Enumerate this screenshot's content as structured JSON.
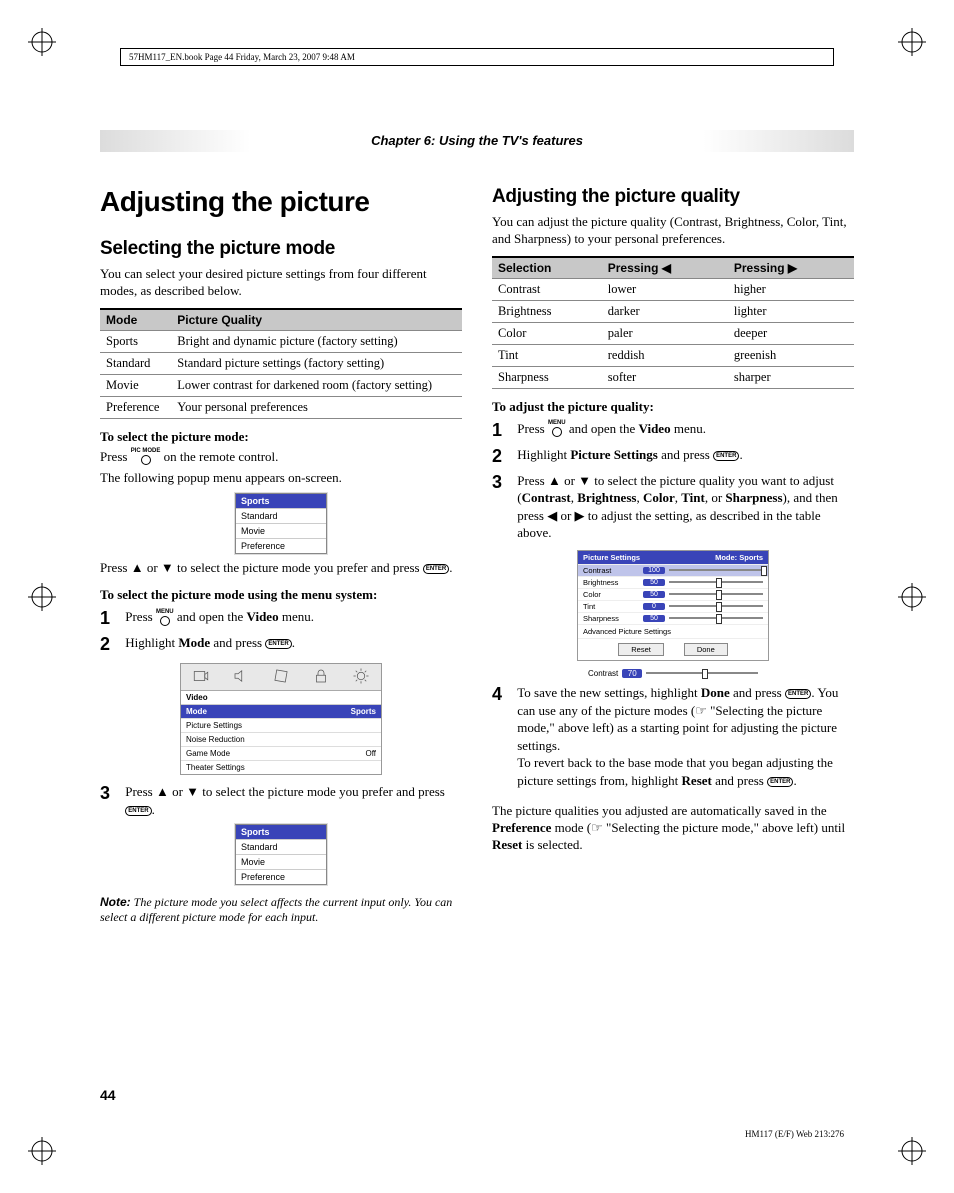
{
  "header_crop": "57HM117_EN.book  Page 44  Friday, March 23, 2007  9:48 AM",
  "chapter_label": "Chapter 6: Using the TV's features",
  "left": {
    "h1": "Adjusting the picture",
    "h2": "Selecting the picture mode",
    "intro": "You can select your desired picture settings from four different modes, as described below.",
    "table_headers": [
      "Mode",
      "Picture Quality"
    ],
    "table_rows": [
      [
        "Sports",
        "Bright and dynamic picture (factory setting)"
      ],
      [
        "Standard",
        "Standard picture settings (factory setting)"
      ],
      [
        "Movie",
        "Lower contrast for darkened room (factory setting)"
      ],
      [
        "Preference",
        "Your personal preferences"
      ]
    ],
    "lead1": "To select the picture mode:",
    "press_line_before": "Press ",
    "pic_mode_label": "PIC MODE",
    "press_line_after": " on the remote control.",
    "popup_line": "The following popup menu appears on-screen.",
    "popup_items": [
      "Sports",
      "Standard",
      "Movie",
      "Preference"
    ],
    "select_line_a": "Press ▲ or ▼ to select the picture mode you prefer and press ",
    "enter_label": "ENTER",
    "select_line_b": ".",
    "lead2": "To select the picture mode using the menu system:",
    "step1_a": "Press ",
    "menu_label": "MENU",
    "step1_b": " and open the ",
    "step1_c": "Video",
    "step1_d": " menu.",
    "step2_a": "Highlight ",
    "step2_b": "Mode",
    "step2_c": " and press ",
    "osd_section": "Video",
    "osd_mode_row": [
      "Mode",
      "Sports"
    ],
    "osd_rows": [
      [
        "Picture Settings",
        ""
      ],
      [
        "Noise Reduction",
        ""
      ],
      [
        "Game Mode",
        "Off"
      ],
      [
        "Theater Settings",
        ""
      ]
    ],
    "step3": "Press ▲ or ▼ to select the picture mode you prefer and press ",
    "note_label": "Note:",
    "note_text": " The picture mode you select affects the current input only. You can select a different picture mode for each input."
  },
  "right": {
    "h2": "Adjusting the picture quality",
    "intro": "You can adjust the picture quality (Contrast, Brightness, Color, Tint, and Sharpness) to your personal preferences.",
    "table_headers": [
      "Selection",
      "Pressing ◀",
      "Pressing ▶"
    ],
    "table_rows": [
      [
        "Contrast",
        "lower",
        "higher"
      ],
      [
        "Brightness",
        "darker",
        "lighter"
      ],
      [
        "Color",
        "paler",
        "deeper"
      ],
      [
        "Tint",
        "reddish",
        "greenish"
      ],
      [
        "Sharpness",
        "softer",
        "sharper"
      ]
    ],
    "lead": "To adjust the picture quality:",
    "step1_a": "Press ",
    "step1_b": " and open the ",
    "step1_c": "Video",
    "step1_d": " menu.",
    "step2_a": "Highlight ",
    "step2_b": "Picture Settings",
    "step2_c": " and press ",
    "step3_a": "Press ▲ or ▼ to select the picture quality you want to adjust (",
    "step3_items": [
      "Contrast",
      "Brightness",
      "Color",
      "Tint",
      "Sharpness"
    ],
    "step3_b": "), and then press ◀ or ▶ to adjust the setting, as described in the table above.",
    "osd_title_left": "Picture Settings",
    "osd_title_right": "Mode: Sports",
    "osd_sliders": [
      {
        "label": "Contrast",
        "val": "100",
        "pos": 98
      },
      {
        "label": "Brightness",
        "val": "50",
        "pos": 50
      },
      {
        "label": "Color",
        "val": "50",
        "pos": 50
      },
      {
        "label": "Tint",
        "val": "0",
        "pos": 50
      },
      {
        "label": "Sharpness",
        "val": "50",
        "pos": 50
      }
    ],
    "osd_link": "Advanced Picture Settings",
    "osd_btns": [
      "Reset",
      "Done"
    ],
    "mini_label": "Contrast",
    "mini_val": "70",
    "step4_a": "To save the new settings, highlight ",
    "step4_done": "Done",
    "step4_b": " and press ",
    "step4_c": ". You can use any of the picture modes (☞ \"Selecting the picture mode,\" above left) as a starting point for adjusting the picture settings.",
    "step4_d": "To revert back to the base mode that you began adjusting the picture settings from, highlight ",
    "step4_reset": "Reset",
    "step4_e": " and press ",
    "closing_a": "The picture qualities you adjusted are automatically saved in the ",
    "closing_b": "Preference",
    "closing_c": " mode (☞ \"Selecting the picture mode,\" above left) until ",
    "closing_d": "Reset",
    "closing_e": " is selected."
  },
  "page_number": "44",
  "footer": "HM117 (E/F) Web 213:276"
}
